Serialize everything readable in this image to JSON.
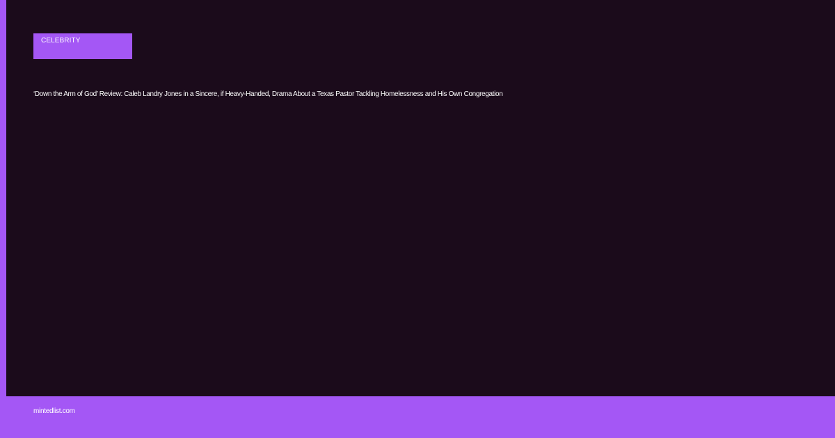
{
  "article": {
    "category": "CELEBRITY",
    "headline": "‘Down the Arm of God’ Review: Caleb Landry Jones in a Sincere, if Heavy-Handed, Drama About a Texas Pastor Tackling Homelessness and His Own Congregation"
  },
  "footer": {
    "site": "mintedlist.com"
  },
  "colors": {
    "accent": "#a457f5",
    "card_background": "#1b0b1b",
    "text": "#ffffff"
  }
}
